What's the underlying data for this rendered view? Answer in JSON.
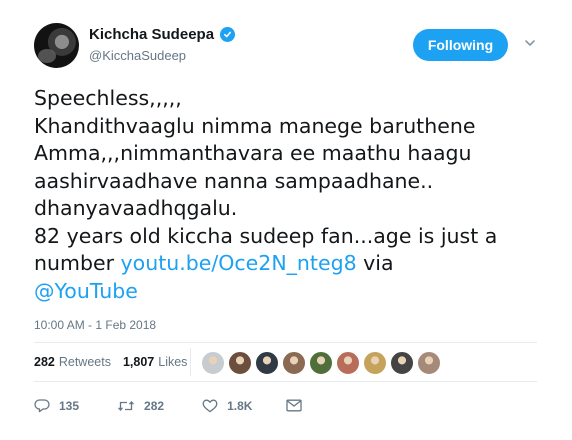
{
  "user": {
    "name": "Kichcha Sudeepa",
    "handle": "@KicchaSudeep",
    "avatar_icon": "profile-photo"
  },
  "follow_button": {
    "label": "Following"
  },
  "tweet": {
    "text_lines": [
      "Speechless,,,,,",
      "Khandithvaaglu nimma manege baruthene",
      "Amma,,,nimmanthavara ee maathu haagu",
      "aashirvaadhave nanna sampaadhane..",
      "dhanyavaadhqgalu.",
      "82 years old kiccha sudeep fan...age is just a",
      "number "
    ],
    "link": "youtu.be/Oce2N_nteg8",
    "after_link": " via",
    "mention": "@YouTube"
  },
  "timestamp": "10:00 AM - 1 Feb 2018",
  "stats": {
    "retweets_count": "282",
    "retweets_label": "Retweets",
    "likes_count": "1,807",
    "likes_label": "Likes"
  },
  "likers": [
    "#c7ccd1",
    "#6b4e3d",
    "#2f3a44",
    "#8a6a52",
    "#4f6f3a",
    "#b86d5a",
    "#c6a35a",
    "#444444",
    "#a58a7a"
  ],
  "actions": {
    "reply_count": "135",
    "retweet_count": "282",
    "like_count": "1.8K"
  },
  "colors": {
    "accent": "#1da1f2",
    "secondary_text": "#657786"
  }
}
